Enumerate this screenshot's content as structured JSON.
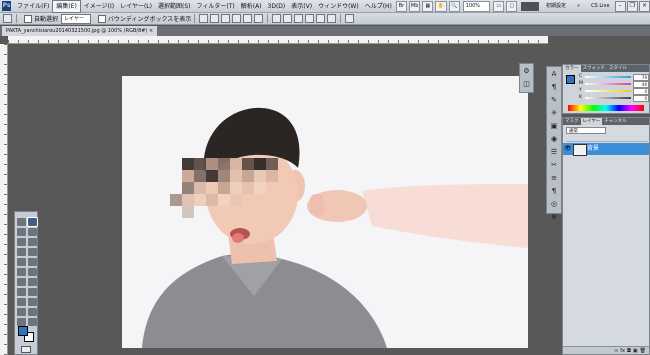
{
  "menu": {
    "logo": "Ps",
    "items": [
      "ファイル(F)",
      "編集(E)",
      "イメージ(I)",
      "レイヤー(L)",
      "選択範囲(S)",
      "フィルター(T)",
      "解析(A)",
      "3D(D)",
      "表示(V)",
      "ウィンドウ(W)",
      "ヘルプ(H)"
    ],
    "zoom": "100%",
    "workspaces": [
      "初期設定"
    ],
    "cs_live": "CS Live"
  },
  "options": {
    "auto_select_label": "自動選択",
    "auto_select_target": "レイヤー",
    "bounding_box_label": "バウンディングボックスを表示"
  },
  "document": {
    "tab_label": "PAKTA_yanchisiarou20140321500.jpg @ 100% (RGB/8#) ×"
  },
  "color_panel": {
    "tabs": [
      "カラー",
      "スウォッチ",
      "スタイル"
    ],
    "sliders": [
      {
        "label": "C",
        "value": "79",
        "color": "#2aa0d8"
      },
      {
        "label": "M",
        "value": "46",
        "color": "#d8409a"
      },
      {
        "label": "Y",
        "value": "0",
        "color": "#e6d400"
      },
      {
        "label": "K",
        "value": "0",
        "color": "#444444"
      }
    ]
  },
  "layers_panel": {
    "tabs": [
      "マスク",
      "レイヤー",
      "チャンネル"
    ],
    "blend_mode": "通常",
    "layer_name": "背景"
  },
  "colors": {
    "foreground": "#2f73c4",
    "background": "#ffffff",
    "accent_layer": "#3b8fd9"
  }
}
